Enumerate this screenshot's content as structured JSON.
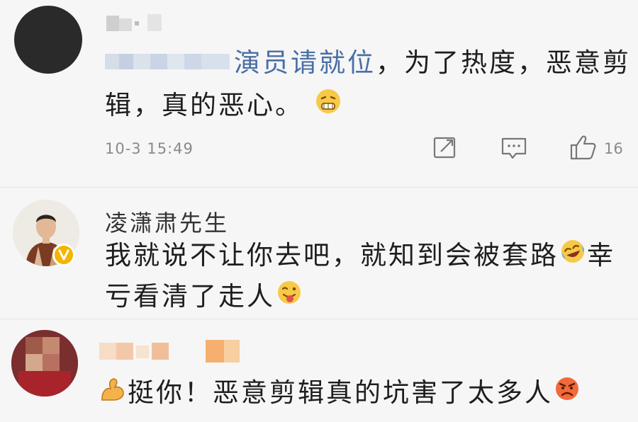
{
  "comments": [
    {
      "mention": "演员请就位",
      "text_line1": "，为了热度，恶意剪",
      "text_line2": "辑，真的恶心。",
      "emoji": "grin-emoji",
      "time": "10-3 15:49",
      "like_count": "16"
    },
    {
      "username": "凌潇肃先生",
      "verified": true,
      "text_line1": "我就说不让你去吧，就知到会被套路",
      "text_line1_end": "幸",
      "text_line2": "亏看清了走人",
      "emoji1": "laugh-cry-emoji",
      "emoji2": "tongue-emoji"
    },
    {
      "text": "挺你！恶意剪辑真的坑害了太多人",
      "emoji_start": "flexed-arm-emoji",
      "emoji_end": "angry-emoji"
    }
  ],
  "colors": {
    "link": "#4a6fa5",
    "text": "#1e1e1e",
    "meta": "#8a8a8a",
    "verified_badge": "#f5b400"
  }
}
